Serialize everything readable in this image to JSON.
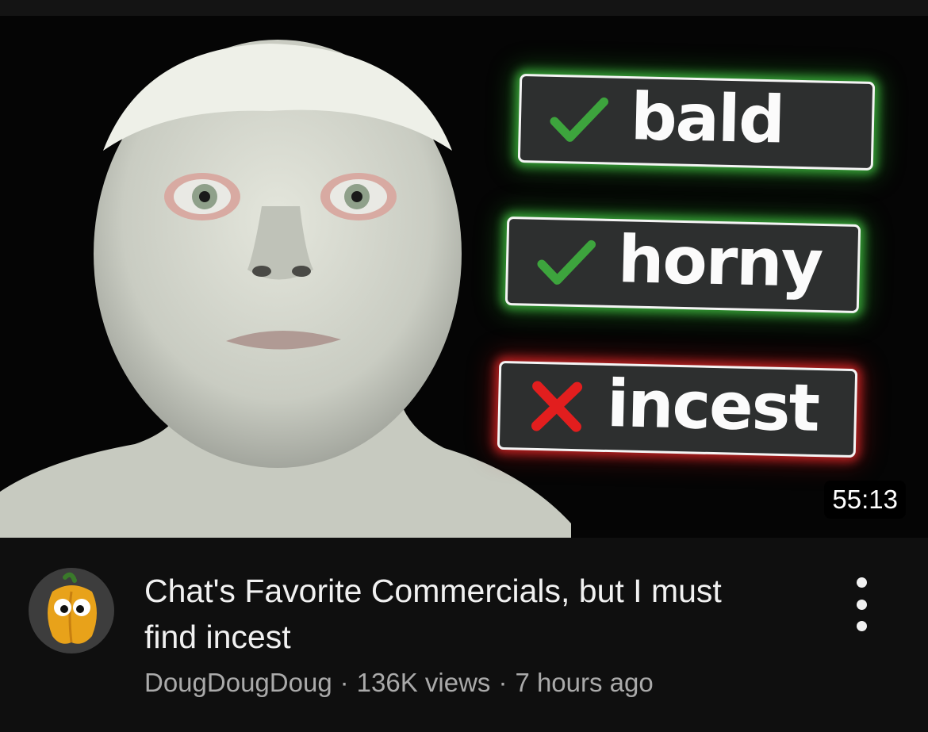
{
  "thumbnail": {
    "tags": [
      {
        "text": "bald",
        "status": "check",
        "glow": "#3fc43f"
      },
      {
        "text": "horny",
        "status": "check",
        "glow": "#3fc43f"
      },
      {
        "text": "incest",
        "status": "cross",
        "glow": "#dd2222"
      }
    ],
    "duration": "55:13",
    "colors": {
      "check": "#3da43d",
      "cross": "#e21e1e",
      "tag_bg": "#2d2f2f"
    }
  },
  "video": {
    "title": "Chat's Favorite Commercials, but I must find incest",
    "channel": "DougDougDoug",
    "separator": "·",
    "views": "136K views",
    "age": "7 hours ago"
  },
  "icons": {
    "avatar": "yellow-pepper-avatar",
    "more": "vertical-ellipsis-icon",
    "check": "checkmark-icon",
    "cross": "x-icon"
  }
}
